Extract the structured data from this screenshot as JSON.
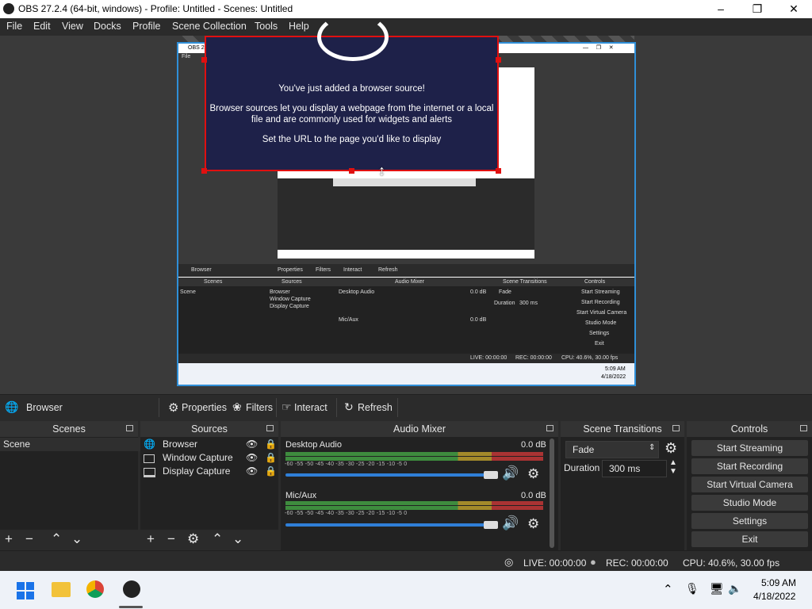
{
  "window": {
    "title": "OBS 27.2.4 (64-bit, windows) - Profile: Untitled - Scenes: Untitled"
  },
  "menu": [
    "File",
    "Edit",
    "View",
    "Docks",
    "Profile",
    "Scene Collection",
    "Tools",
    "Help"
  ],
  "preview": {
    "message_line1": "You've just added a browser source!",
    "message_line2": "Browser sources let you display a webpage from the internet or a local",
    "message_line3": "file and are commonly used for widgets and alerts",
    "message_line4": "Set the URL to the page you'd like to display"
  },
  "source_toolbar": {
    "source_name": "Browser",
    "properties": "Properties",
    "filters": "Filters",
    "interact": "Interact",
    "refresh": "Refresh"
  },
  "scenes": {
    "header": "Scenes",
    "items": [
      "Scene"
    ]
  },
  "sources": {
    "header": "Sources",
    "items": [
      "Browser",
      "Window Capture",
      "Display Capture"
    ]
  },
  "mixer": {
    "header": "Audio Mixer",
    "ticks": "-60  -55  -50  -45  -40  -35  -30  -25  -20  -15  -10  -5  0",
    "channels": [
      {
        "name": "Desktop Audio",
        "level": "0.0 dB",
        "volume": 1.0
      },
      {
        "name": "Mic/Aux",
        "level": "0.0 dB",
        "volume": 1.0
      }
    ]
  },
  "transitions": {
    "header": "Scene Transitions",
    "selected": "Fade",
    "duration_label": "Duration",
    "duration_value": "300 ms"
  },
  "controls": {
    "header": "Controls",
    "buttons": [
      "Start Streaming",
      "Start Recording",
      "Start Virtual Camera",
      "Studio Mode",
      "Settings",
      "Exit"
    ]
  },
  "status": {
    "live": "LIVE: 00:00:00",
    "rec": "REC: 00:00:00",
    "cpu": "CPU: 40.6%, 30.00 fps"
  },
  "taskbar": {
    "time": "5:09 AM",
    "date": "4/18/2022"
  },
  "nested": {
    "title": "OBS 27",
    "menu_file": "File",
    "source_name": "Browser",
    "properties": "Properties",
    "filters": "Filters",
    "interact": "Interact",
    "refresh": "Refresh",
    "scenes": "Scenes",
    "sources": "Sources",
    "mixer": "Audio Mixer",
    "transitions": "Scene Transitions",
    "controls": "Controls",
    "scene": "Scene",
    "src1": "Browser",
    "src2": "Window Capture",
    "src3": "Display Capture",
    "desk": "Desktop Audio",
    "mic": "Mic/Aux",
    "db": "0.0 dB",
    "fade": "Fade",
    "duration": "Duration",
    "dur_val": "300 ms",
    "btn1": "Start Streaming",
    "btn2": "Start Recording",
    "btn3": "Start Virtual Camera",
    "btn4": "Studio Mode",
    "btn5": "Settings",
    "btn6": "Exit",
    "live": "LIVE: 00:00:00",
    "rec": "REC: 00:00:00",
    "cpu": "CPU: 40.6%, 30.00 fps",
    "time": "5:09 AM",
    "date": "4/18/2022"
  }
}
